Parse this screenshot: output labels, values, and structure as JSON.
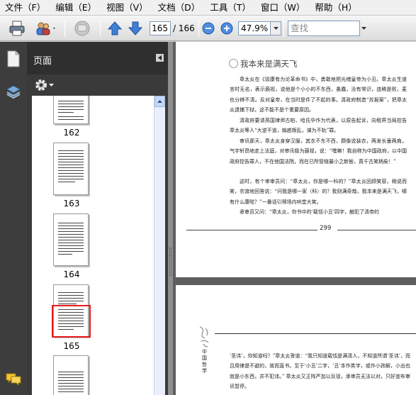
{
  "menu": [
    "文件（F）",
    "编辑（E）",
    "视图（V）",
    "文档（D）",
    "工具（T）",
    "窗口（W）",
    "帮助（H）"
  ],
  "toolbar": {
    "page_current": "165",
    "page_total": "/ 166",
    "zoom": "47.9%",
    "search_placeholder": "查找",
    "icons": [
      "print-icon",
      "share-icon",
      "comments-icon",
      "previous-page-icon",
      "next-page-icon",
      "zoom-out-icon",
      "zoom-in-icon"
    ]
  },
  "panel": {
    "title": "页面",
    "thumbnails": [
      "162",
      "163",
      "164",
      "165"
    ],
    "selected": "165"
  },
  "document": {
    "page299": {
      "chapter_title": "我本来是满天飞",
      "paragraphs": [
        "章太炎在《驳康有为论革命书》中，勇敢地把光绪皇帝为小丑。章太炎生道言时无名，表示藐视，说他是个小小的不东西，愚蠢，没有常识，连稀是败，麦也分辨不清。反对皇帝，在当时是件了不起的事。清政府制造“苏报案”，把章太炎逮捕下狱，这不能不是个重要原因。",
        "清政府要请英国律师古柏、哈氏华作为代表，以原告起诉，向租界当局控告章太炎等人“大逆不道，煽惑叛乱，谋为不轨”罪。",
        "审讯那天，章太炎身穿汉服，其衣不东不西，颇像说装衣，两发长垂两肩，气宇轩昂地走上法庭，对审讯极为藐视，说：“嘿嘛！我自称为中国政府，以中国政府控告罪人，不在他国法院，而在已所管辖最小之新衙，真千古笑柄矣！”",
        "这时，有个审审员问：“章太炎，你是哪一科的？”章太炎回顾笑容，稍说而笑，农渡地回答说：“问我是哪一家（科）的？我则满奇哉，我本来是满天飞，哪有什么康啦？”一番话引得场内哄堂大笑。",
        "承审员又问：“章太炎，你书中的‘载恬小丑’四字，触犯了清帝的"
      ],
      "page_number": "299"
    },
    "page300": {
      "side_title": "中国哲学",
      "paragraph": "‘圣讳’，你知道吗？”章太炎答道：“我只知道载恬是满清人，不知道所谓‘圣讳’，而且用律是不避的，故而直书。至于‘小丑’二字，‘丑’本作类字，或作小孩解，小出也就是小东西，并不犯讳。” 章太炎又正阵严加以反驳，承审员无法以对，只好宣布审讯暂停。"
    }
  }
}
